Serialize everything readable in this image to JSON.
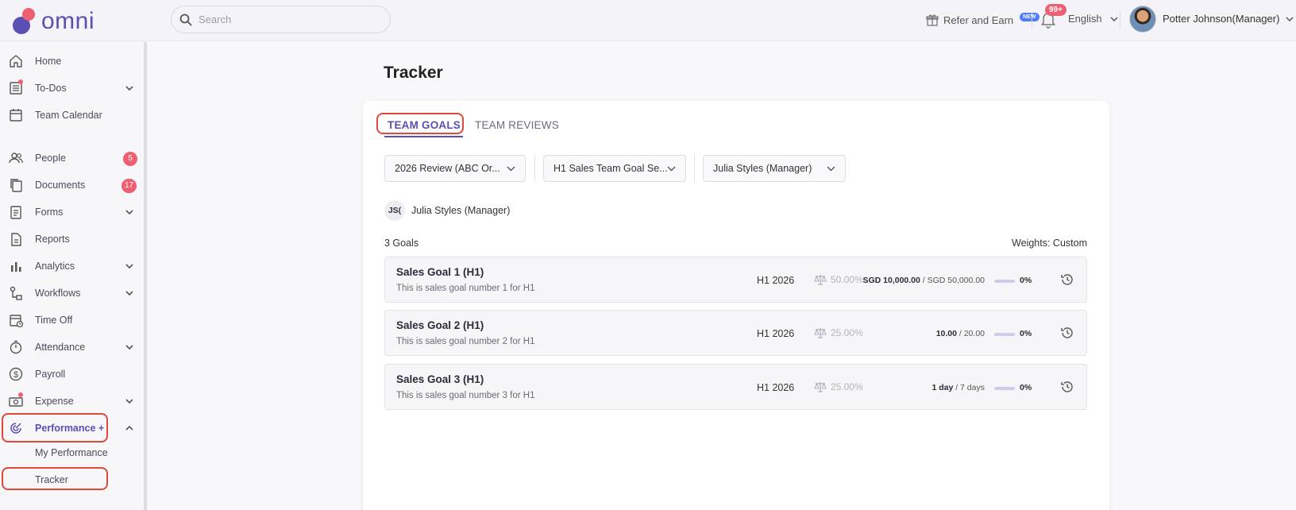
{
  "brand": {
    "name": "omni"
  },
  "header": {
    "search_placeholder": "Search",
    "refer_label": "Refer and Earn",
    "new_badge": "NEW",
    "notifications_badge": "99+",
    "language": "English",
    "user_name": "Potter Johnson(Manager)"
  },
  "sidebar": {
    "items": [
      {
        "label": "Home",
        "icon": "home-icon"
      },
      {
        "label": "To-Dos",
        "icon": "todo-list-icon",
        "dot": true,
        "chevron": "down"
      },
      {
        "label": "Team Calendar",
        "icon": "calendar-icon"
      },
      {
        "label": "People",
        "icon": "people-icon",
        "badge": "5"
      },
      {
        "label": "Documents",
        "icon": "documents-icon",
        "badge": "17"
      },
      {
        "label": "Forms",
        "icon": "forms-icon",
        "chevron": "down"
      },
      {
        "label": "Reports",
        "icon": "report-icon"
      },
      {
        "label": "Analytics",
        "icon": "analytics-icon",
        "chevron": "down"
      },
      {
        "label": "Workflows",
        "icon": "workflows-icon",
        "chevron": "down"
      },
      {
        "label": "Time Off",
        "icon": "time-off-icon"
      },
      {
        "label": "Attendance",
        "icon": "stopwatch-icon",
        "chevron": "down"
      },
      {
        "label": "Payroll",
        "icon": "dollar-icon"
      },
      {
        "label": "Expense",
        "icon": "expense-icon",
        "dot": true,
        "chevron": "down"
      },
      {
        "label": "Performance +",
        "icon": "performance-icon",
        "chevron": "up",
        "active": true
      }
    ],
    "sub_items": [
      {
        "label": "My Performance"
      },
      {
        "label": "Tracker"
      }
    ]
  },
  "page": {
    "title": "Tracker",
    "tabs": [
      {
        "label": "TEAM GOALS",
        "active": true
      },
      {
        "label": "TEAM REVIEWS",
        "active": false
      }
    ],
    "filters": [
      {
        "value": "2026 Review (ABC Or..."
      },
      {
        "value": "H1 Sales Team Goal Se..."
      },
      {
        "value": "Julia Styles (Manager)"
      }
    ],
    "selected_person": {
      "initials": "JS(",
      "name": "Julia Styles (Manager)"
    },
    "goals_count": "3 Goals",
    "weights": "Weights: Custom",
    "goals": [
      {
        "title": "Sales Goal 1 (H1)",
        "description": "This is sales goal number 1 for H1",
        "period": "H1 2026",
        "weight": "50.00%",
        "current": "SGD 10,000.00",
        "target": " / SGD 50,000.00",
        "percent": "0%",
        "progress": 0
      },
      {
        "title": "Sales Goal 2 (H1)",
        "description": "This is sales goal number 2 for H1",
        "period": "H1 2026",
        "weight": "25.00%",
        "current": "10.00",
        "target": " / 20.00",
        "percent": "0%",
        "progress": 0
      },
      {
        "title": "Sales Goal 3 (H1)",
        "description": "This is sales goal number 3 for H1",
        "period": "H1 2026",
        "weight": "25.00%",
        "current": "1 day",
        "target": " / 7 days",
        "percent": "0%",
        "progress": 0
      }
    ]
  },
  "colors": {
    "accent": "#5a4fb3",
    "badge": "#ef5f72",
    "highlight": "#e0483b"
  }
}
